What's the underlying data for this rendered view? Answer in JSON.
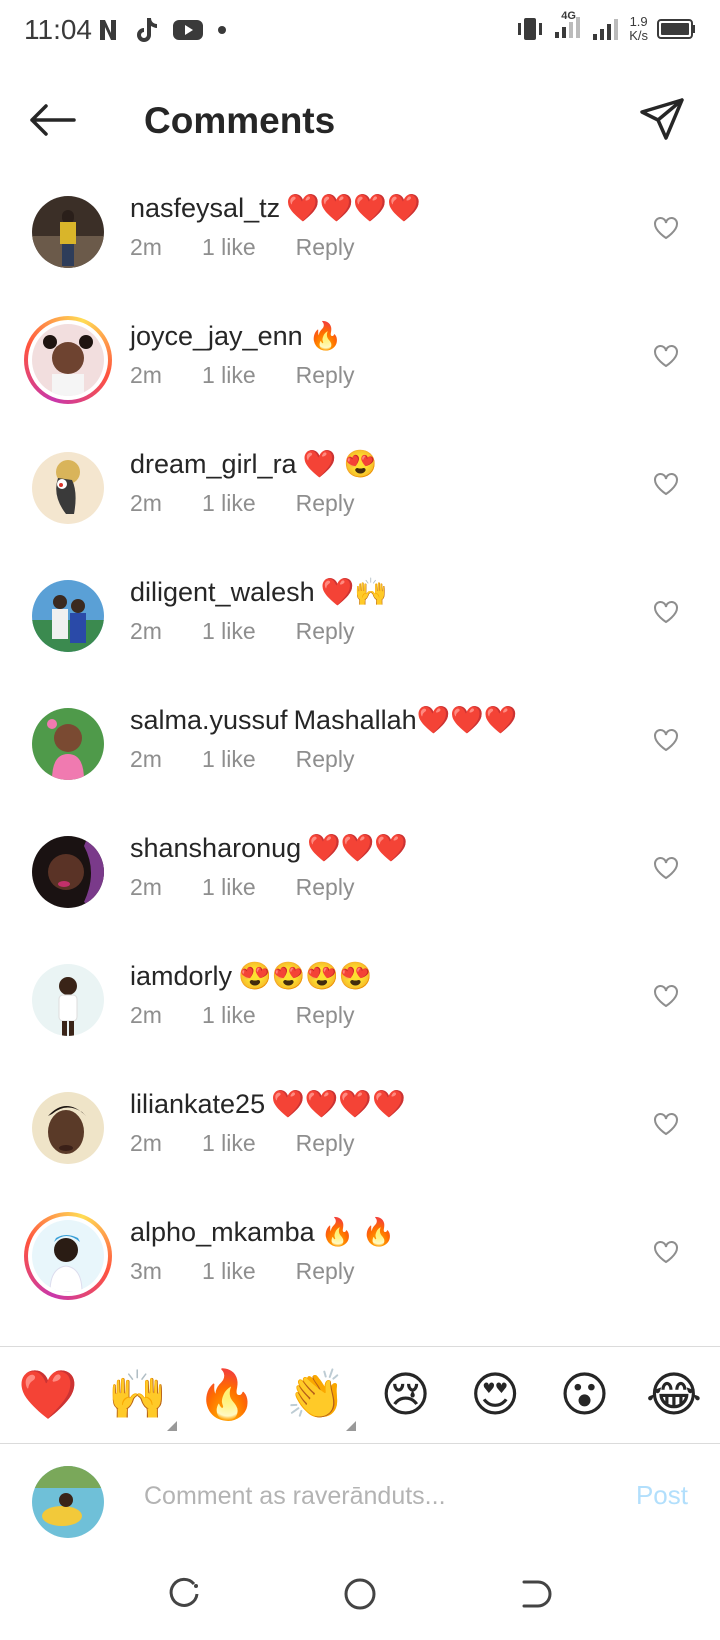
{
  "status_bar": {
    "time": "11:04",
    "network": "4G",
    "speed_value": "1.9",
    "speed_unit": "K/s"
  },
  "header": {
    "title": "Comments"
  },
  "comments": [
    {
      "username": "nasfeysal_tz",
      "message": "❤️❤️❤️❤️",
      "time": "2m",
      "likes": "1 like",
      "reply": "Reply"
    },
    {
      "username": "joyce_jay_enn",
      "message": "🔥",
      "time": "2m",
      "likes": "1 like",
      "reply": "Reply"
    },
    {
      "username": "dream_girl_ra",
      "message": "❤️ 😍",
      "time": "2m",
      "likes": "1 like",
      "reply": "Reply"
    },
    {
      "username": "diligent_walesh",
      "message": "❤️🙌",
      "time": "2m",
      "likes": "1 like",
      "reply": "Reply"
    },
    {
      "username": "salma.yussuf",
      "message": "Mashallah❤️❤️❤️",
      "time": "2m",
      "likes": "1 like",
      "reply": "Reply"
    },
    {
      "username": "shansharonug",
      "message": "❤️❤️❤️",
      "time": "2m",
      "likes": "1 like",
      "reply": "Reply"
    },
    {
      "username": "iamdorly",
      "message": "😍😍😍😍",
      "time": "2m",
      "likes": "1 like",
      "reply": "Reply"
    },
    {
      "username": "liliankate25",
      "message": "❤️❤️❤️❤️",
      "time": "2m",
      "likes": "1 like",
      "reply": "Reply"
    },
    {
      "username": "alpho_mkamba",
      "message": "🔥 🔥",
      "time": "3m",
      "likes": "1 like",
      "reply": "Reply"
    }
  ],
  "emoji_bar": [
    "❤️",
    "🙌",
    "🔥",
    "👏",
    "😢",
    "😍",
    "😮",
    "😂"
  ],
  "composer": {
    "placeholder": "Comment as raverānduts...",
    "post_label": "Post"
  },
  "colors": {
    "text": "#262626",
    "meta": "#8e8e8e",
    "post_disabled": "#b2dffc",
    "divider": "#dbdbdb"
  }
}
